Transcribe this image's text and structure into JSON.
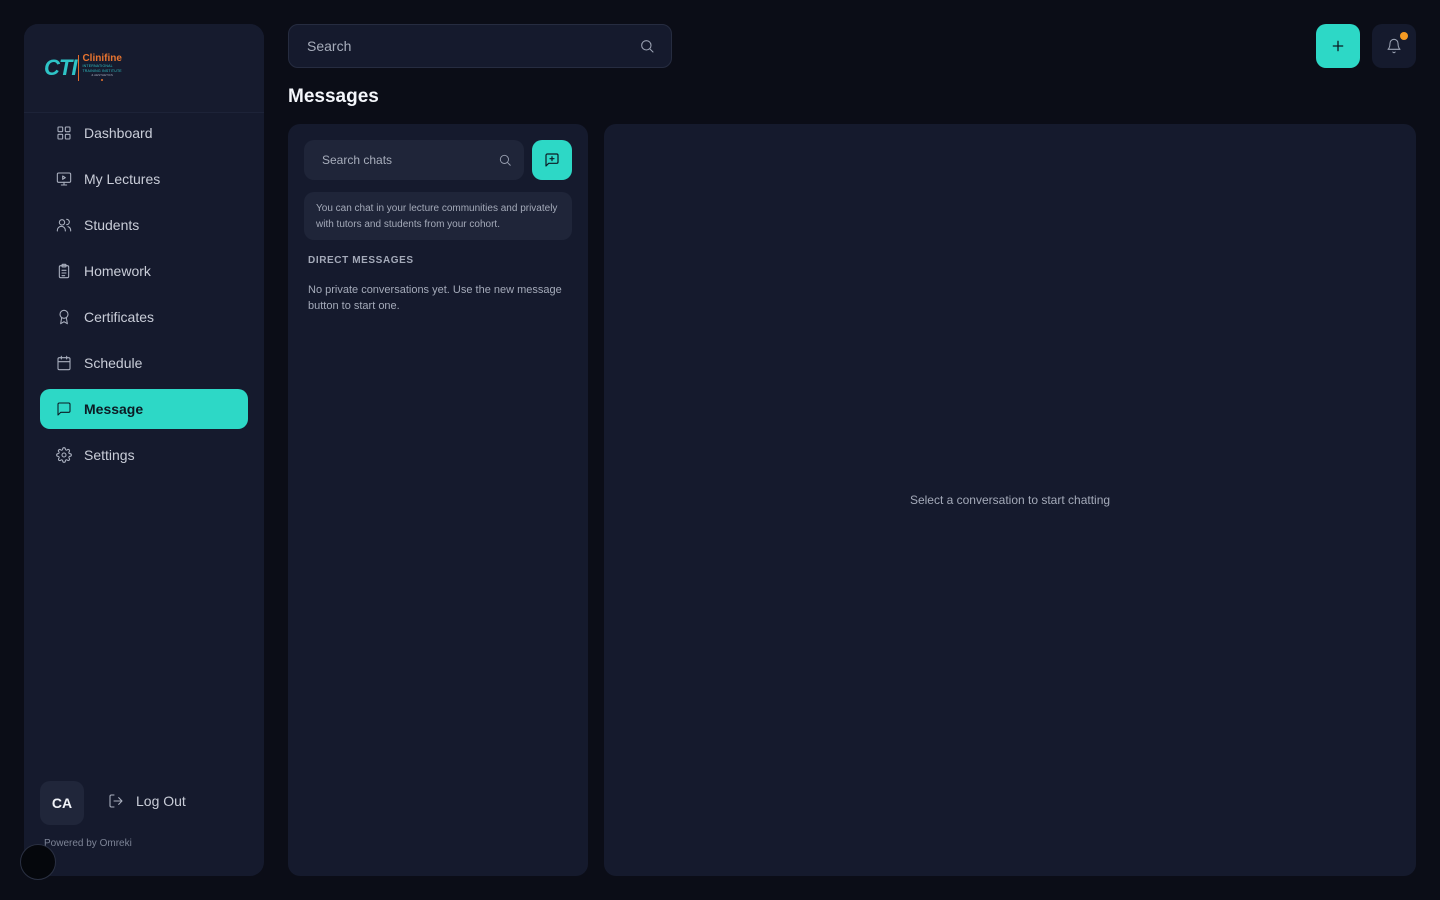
{
  "brand": {
    "logo_mark": "CTI",
    "logo_name": "Clinifine",
    "logo_line1": "INTERNATIONAL",
    "logo_line2": "TRAINING INSTITUTE",
    "logo_line3": "& AESTHETICS"
  },
  "sidebar": {
    "items": [
      {
        "label": "Dashboard",
        "icon": "grid-icon",
        "active": false
      },
      {
        "label": "My Lectures",
        "icon": "monitor-play-icon",
        "active": false
      },
      {
        "label": "Students",
        "icon": "users-icon",
        "active": false
      },
      {
        "label": "Homework",
        "icon": "clipboard-icon",
        "active": false
      },
      {
        "label": "Certificates",
        "icon": "award-icon",
        "active": false
      },
      {
        "label": "Schedule",
        "icon": "calendar-icon",
        "active": false
      },
      {
        "label": "Message",
        "icon": "message-square-icon",
        "active": true
      },
      {
        "label": "Settings",
        "icon": "gear-icon",
        "active": false
      }
    ],
    "user_initials": "CA",
    "logout_label": "Log Out",
    "powered_by": "Powered by Omreki"
  },
  "header": {
    "search_placeholder": "Search",
    "add_icon": "plus-icon",
    "notification_icon": "bell-icon",
    "notification_dot_color": "#f59a23"
  },
  "page": {
    "title": "Messages"
  },
  "chat_list": {
    "search_placeholder": "Search chats",
    "new_message_icon": "message-plus-icon",
    "info_text": "You can chat in your lecture communities and privately with tutors and students from your cohort.",
    "direct_messages_heading": "DIRECT MESSAGES",
    "empty_text": "No private conversations yet. Use the new message button to start one."
  },
  "conversation": {
    "empty_text": "Select a conversation to start chatting"
  },
  "colors": {
    "accent": "#2dd8c6",
    "background": "#0b0d17",
    "panel": "#151a2d"
  }
}
